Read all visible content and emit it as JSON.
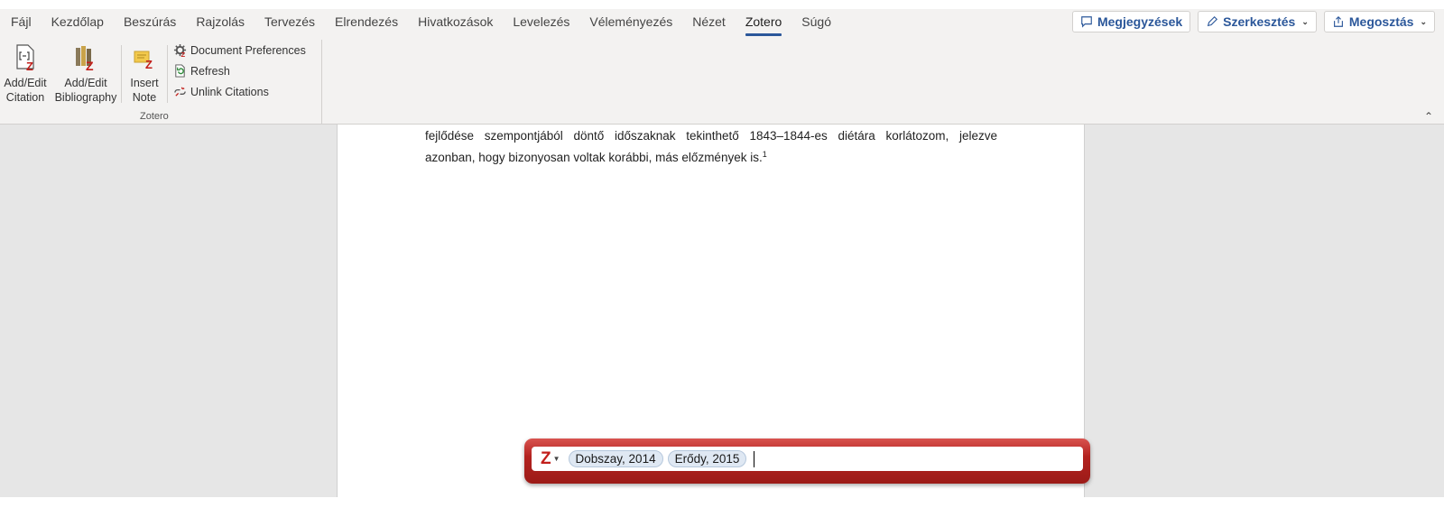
{
  "ribbon": {
    "tabs": [
      "Fájl",
      "Kezdőlap",
      "Beszúrás",
      "Rajzolás",
      "Tervezés",
      "Elrendezés",
      "Hivatkozások",
      "Levelezés",
      "Véleményezés",
      "Nézet",
      "Zotero",
      "Súgó"
    ],
    "active_tab": "Zotero",
    "actions": {
      "comments": "Megjegyzések",
      "editing": "Szerkesztés",
      "share": "Megosztás"
    },
    "commands": {
      "add_edit_citation_line1": "Add/Edit",
      "add_edit_citation_line2": "Citation",
      "add_edit_bibliography_line1": "Add/Edit",
      "add_edit_bibliography_line2": "Bibliography",
      "insert_note_line1": "Insert",
      "insert_note_line2": "Note",
      "document_preferences": "Document Preferences",
      "refresh": "Refresh",
      "unlink_citations": "Unlink Citations"
    },
    "group_label": "Zotero"
  },
  "document": {
    "line1": "fejlődése szempontjából döntő időszaknak tekinthető 1843–1844-es diétára korlátozom, jelezve",
    "line2": "azonban, hogy bizonyosan voltak korábbi, más előzmények is.",
    "footnote_ref": "1"
  },
  "zotero_bar": {
    "logo": "Z",
    "citations": [
      "Dobszay, 2014",
      "Erődy, 2015"
    ]
  },
  "colors": {
    "accent": "#2b579a",
    "zotero_red": "#b3221f",
    "bubble_bg": "#dfe8f3"
  }
}
